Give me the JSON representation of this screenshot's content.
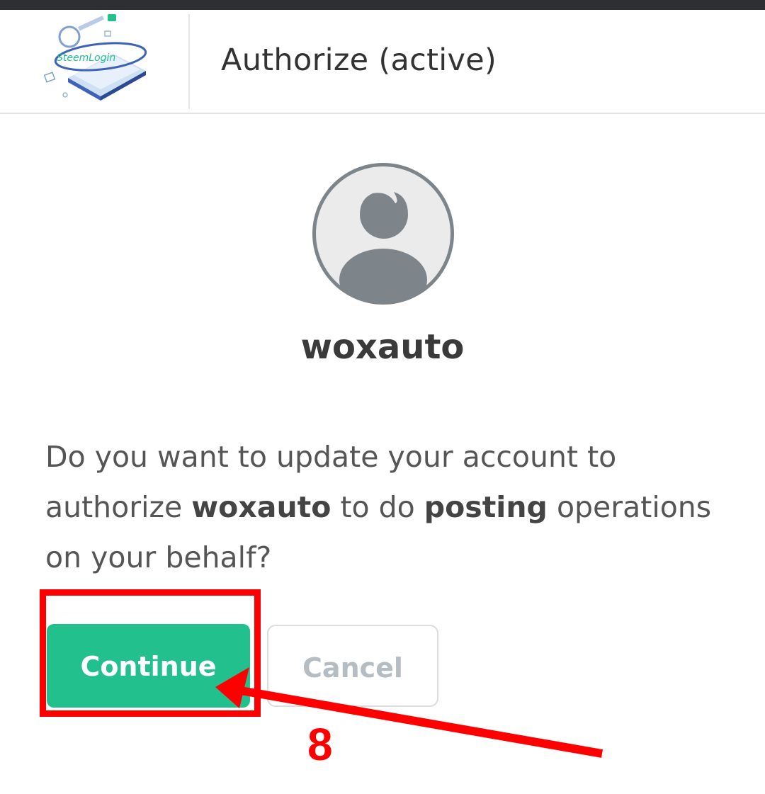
{
  "header": {
    "logo_text": "SteemLogin",
    "title": "Authorize (active)"
  },
  "account": {
    "username": "woxauto"
  },
  "message": {
    "part1": "Do you want to update your account to authorize ",
    "account": "woxauto",
    "part2": " to do ",
    "operation": "posting",
    "part3": " operations on your behalf?"
  },
  "actions": {
    "continue_label": "Continue",
    "cancel_label": "Cancel"
  },
  "annotation": {
    "step_number": "8",
    "color": "#ff0000"
  },
  "colors": {
    "primary": "#22c08c",
    "avatar": "#7d858b",
    "text": "#555555"
  }
}
